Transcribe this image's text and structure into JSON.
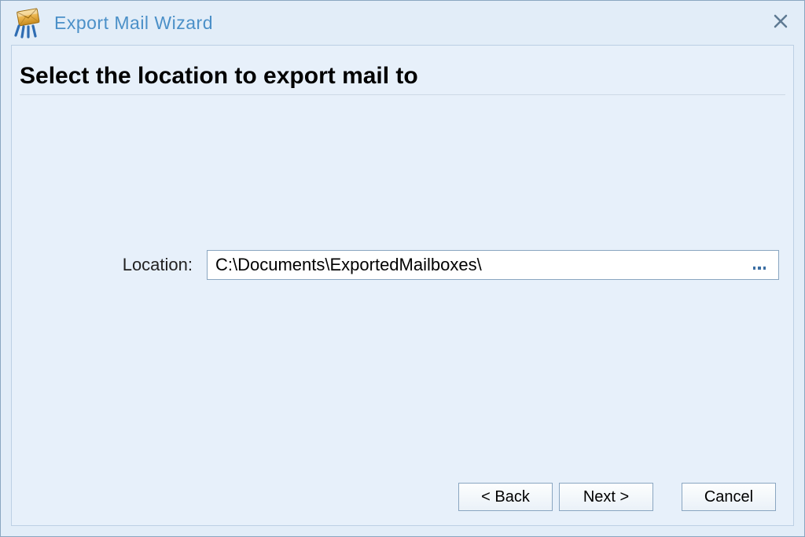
{
  "window": {
    "title": "Export Mail Wizard"
  },
  "page": {
    "heading": "Select the location to export mail to"
  },
  "form": {
    "location_label": "Location:",
    "location_value": "C:\\Documents\\ExportedMailboxes\\"
  },
  "buttons": {
    "back": "< Back",
    "next": "Next >",
    "cancel": "Cancel"
  }
}
